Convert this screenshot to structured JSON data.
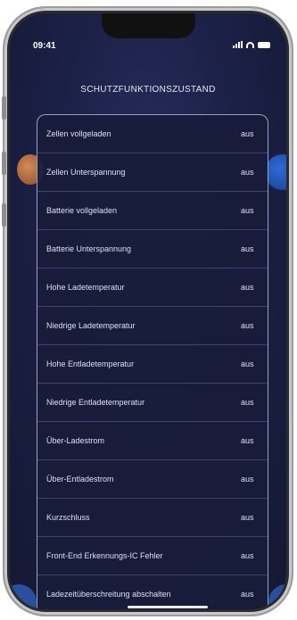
{
  "status": {
    "time": "09:41"
  },
  "screen_title": "SCHUTZFUNKTIONSZUSTAND",
  "protections": [
    {
      "label": "Zellen vollgeladen",
      "value": "aus"
    },
    {
      "label": "Zellen Unterspannung",
      "value": "aus"
    },
    {
      "label": "Batterie vollgeladen",
      "value": "aus"
    },
    {
      "label": "Batterie Unterspannung",
      "value": "aus"
    },
    {
      "label": "Hohe Ladetemperatur",
      "value": "aus"
    },
    {
      "label": "Niedrige Ladetemperatur",
      "value": "aus"
    },
    {
      "label": "Hohe Entladetemperatur",
      "value": "aus"
    },
    {
      "label": "Niedrige Entladetemperatur",
      "value": "aus"
    },
    {
      "label": "Über-Ladestrom",
      "value": "aus"
    },
    {
      "label": "Über-Entladestrom",
      "value": "aus"
    },
    {
      "label": "Kurzschluss",
      "value": "aus"
    },
    {
      "label": "Front-End Erkennungs-IC Fehler",
      "value": "aus"
    },
    {
      "label": "Ladezeitüberschreitung abschalten",
      "value": "aus"
    }
  ],
  "colors": {
    "background": "#1c2148",
    "text": "#dde0f2",
    "divider": "#3b4170"
  },
  "icons": [
    "signal-icon",
    "wifi-icon",
    "battery-icon"
  ]
}
